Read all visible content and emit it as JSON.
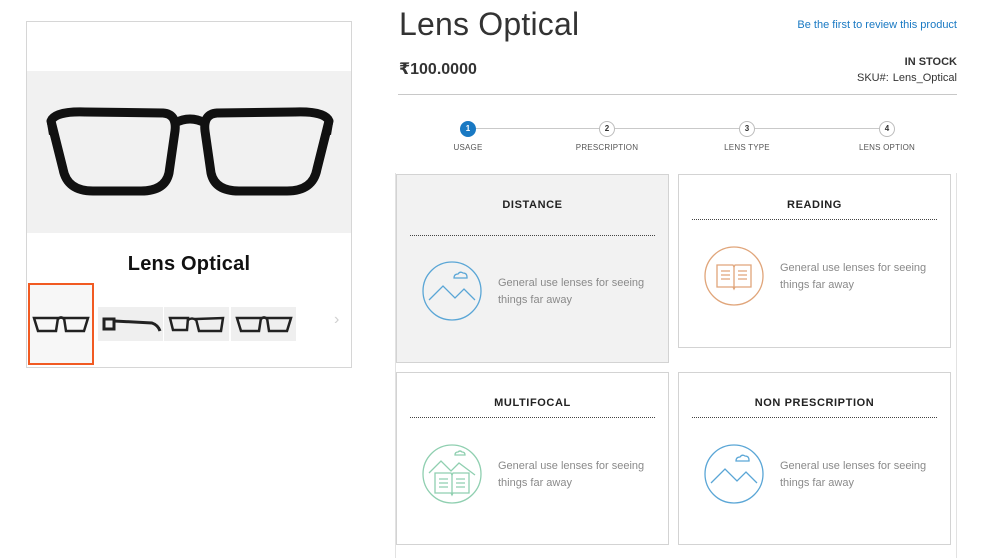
{
  "gallery": {
    "title": "Lens Optical",
    "next_icon": "chevron-right-icon",
    "thumbnails": [
      {
        "alt": "front-view",
        "active": true
      },
      {
        "alt": "side-view",
        "active": false
      },
      {
        "alt": "angle-view",
        "active": false
      },
      {
        "alt": "front-view-2",
        "active": false
      }
    ]
  },
  "product": {
    "title": "Lens Optical",
    "review_link": "Be the first to review this product",
    "price": "₹100.0000",
    "stock": "IN STOCK",
    "sku_label": "SKU#:",
    "sku_value": "Lens_Optical"
  },
  "steps": [
    {
      "number": "1",
      "label": "USAGE",
      "active": true
    },
    {
      "number": "2",
      "label": "PRESCRIPTION",
      "active": false
    },
    {
      "number": "3",
      "label": "LENS TYPE",
      "active": false
    },
    {
      "number": "4",
      "label": "LENS OPTION",
      "active": false
    }
  ],
  "options": [
    {
      "title": "DISTANCE",
      "description": "General use lenses for seeing things far away",
      "icon": "mountain-cloud-icon",
      "color": "#5aa6d6",
      "selected": true
    },
    {
      "title": "READING",
      "description": "General use lenses for seeing things far away",
      "icon": "book-icon",
      "color": "#e0a57a",
      "selected": false
    },
    {
      "title": "MULTIFOCAL",
      "description": "General use lenses for seeing things far away",
      "icon": "mountain-book-icon",
      "color": "#8fcfb0",
      "selected": false
    },
    {
      "title": "NON PRESCRIPTION",
      "description": "General use lenses for seeing things far away",
      "icon": "mountain-cloud-icon",
      "color": "#5aa6d6",
      "selected": false
    }
  ],
  "colors": {
    "accent": "#1979c3",
    "thumb_active_border": "#f15a22"
  }
}
